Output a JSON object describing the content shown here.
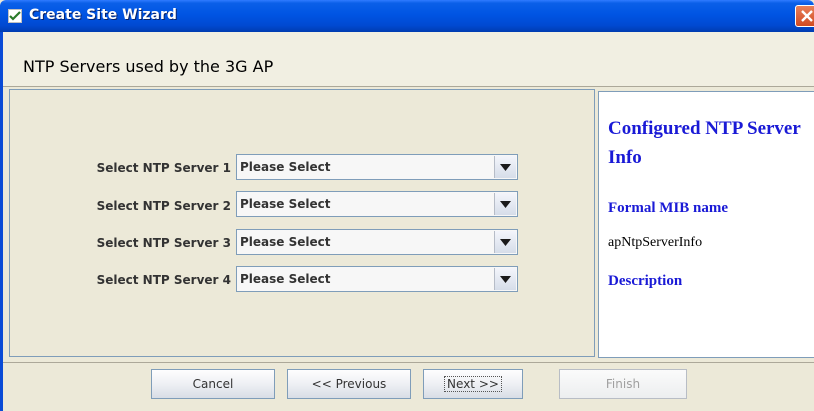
{
  "window": {
    "title": "Create Site Wizard",
    "title_icon": "checkmark-shield-icon",
    "close_icon": "close-icon"
  },
  "header": {
    "title": "NTP Servers used by the 3G AP"
  },
  "form": {
    "rows": [
      {
        "label": "Select NTP Server 1",
        "value": "Please Select"
      },
      {
        "label": "Select NTP Server 2",
        "value": "Please Select"
      },
      {
        "label": "Select NTP Server 3",
        "value": "Please Select"
      },
      {
        "label": "Select NTP Server 4",
        "value": "Please Select"
      }
    ]
  },
  "info": {
    "heading": "Configured NTP Server Info",
    "mib_label": "Formal MIB name",
    "mib_value": "apNtpServerInfo",
    "description_label": "Description"
  },
  "buttons": {
    "cancel": "Cancel",
    "previous": "<< Previous",
    "next": "Next >>",
    "finish": "Finish"
  },
  "colors": {
    "title_bar": "#0054e3",
    "info_text": "#1a1ad6",
    "background": "#ece9d8"
  }
}
